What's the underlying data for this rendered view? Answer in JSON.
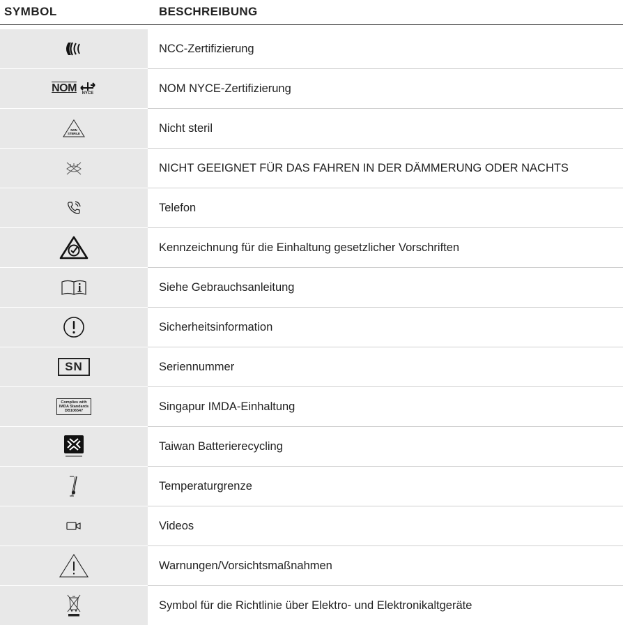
{
  "header": {
    "symbol_label": "SYMBOL",
    "description_label": "BESCHREIBUNG"
  },
  "rows": [
    {
      "icon": "ncc-icon",
      "description": "NCC-Zertifizierung"
    },
    {
      "icon": "nom-nyce-icon",
      "description": "NOM NYCE-Zertifizierung",
      "icon_text": "NOM",
      "icon_subtext": "NYCE"
    },
    {
      "icon": "non-sterile-icon",
      "description": "Nicht steril",
      "icon_text": "NON",
      "icon_subtext": "STERILE"
    },
    {
      "icon": "not-for-night-driving-icon",
      "description": "NICHT GEEIGNET FÜR DAS FAHREN IN DER DÄMMERUNG ODER NACHTS"
    },
    {
      "icon": "phone-icon",
      "description": "Telefon"
    },
    {
      "icon": "rcm-icon",
      "description": "Kennzeichnung für die Einhaltung gesetzlicher Vorschriften"
    },
    {
      "icon": "manual-info-icon",
      "description": "Siehe Gebrauchsanleitung"
    },
    {
      "icon": "safety-info-icon",
      "description": "Sicherheitsinformation"
    },
    {
      "icon": "serial-number-icon",
      "description": "Seriennummer",
      "icon_text": "SN"
    },
    {
      "icon": "imda-icon",
      "description": "Singapur IMDA-Einhaltung",
      "icon_lines": [
        "Complies with",
        "IMDA Standards",
        "DB106547"
      ]
    },
    {
      "icon": "taiwan-battery-recycling-icon",
      "description": "Taiwan Batterierecycling"
    },
    {
      "icon": "temperature-limit-icon",
      "description": "Temperaturgrenze"
    },
    {
      "icon": "video-icon",
      "description": "Videos"
    },
    {
      "icon": "warning-icon",
      "description": "Warnungen/Vorsichtsmaßnahmen"
    },
    {
      "icon": "weee-icon",
      "description": "Symbol für die Richtlinie über Elektro- und Elektronikaltgeräte"
    }
  ]
}
